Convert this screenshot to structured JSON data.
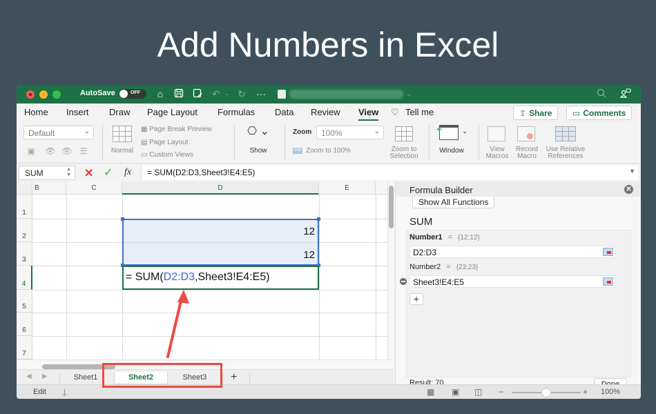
{
  "headline": "Add Numbers in Excel",
  "titlebar": {
    "autosave_label": "AutoSave",
    "autosave_state": "OFF",
    "document_name": "(blurred)",
    "icons": [
      "home-icon",
      "save-icon",
      "save-as-icon",
      "undo-icon",
      "redo-icon",
      "more-icon",
      "excel-doc-icon",
      "search-icon",
      "collaborate-icon"
    ]
  },
  "ribbon_tabs": [
    {
      "label": "Home",
      "active": false
    },
    {
      "label": "Insert",
      "active": false
    },
    {
      "label": "Draw",
      "active": false
    },
    {
      "label": "Page Layout",
      "active": false
    },
    {
      "label": "Formulas",
      "active": false
    },
    {
      "label": "Data",
      "active": false
    },
    {
      "label": "Review",
      "active": false
    },
    {
      "label": "View",
      "active": true
    },
    {
      "label": "Tell me",
      "active": false
    }
  ],
  "share_label": "Share",
  "comments_label": "Comments",
  "ribbon": {
    "sheet_view_select": "Default",
    "normal_label": "Normal",
    "page_break_preview": "Page Break Preview",
    "page_layout": "Page Layout",
    "custom_views": "Custom Views",
    "show_label": "Show",
    "zoom_label": "Zoom",
    "zoom_value": "100%",
    "zoom_to_100": "Zoom to 100%",
    "zoom_badge": "100",
    "zoom_to_selection": [
      "Zoom to",
      "Selection"
    ],
    "window_label": "Window",
    "view_macros": [
      "View",
      "Macros"
    ],
    "record_macro": [
      "Record",
      "Macro"
    ],
    "use_relative": [
      "Use Relative",
      "References"
    ]
  },
  "formula_bar": {
    "name_box": "SUM",
    "formula": "= SUM(D2:D3,Sheet3!E4:E5)",
    "fx_label": "fx"
  },
  "sheet": {
    "columns": [
      "B",
      "C",
      "D",
      "E"
    ],
    "selected_column": "D",
    "rows": [
      "1",
      "2",
      "3",
      "4",
      "5",
      "6",
      "7"
    ],
    "selected_row": "4",
    "cells": {
      "D2": "12",
      "D3": "12"
    },
    "editing_cell": {
      "prefix": "= SUM(",
      "ref": "D2:D3",
      "suffix": ",Sheet3!E4:E5)"
    }
  },
  "sheet_tabs": [
    {
      "label": "Sheet1",
      "active": false
    },
    {
      "label": "Sheet2",
      "active": true
    },
    {
      "label": "Sheet3",
      "active": false
    }
  ],
  "statusbar": {
    "mode": "Edit",
    "zoom_percent": "100%",
    "zoom_slider_fraction": 0.5
  },
  "formula_builder": {
    "title": "Formula Builder",
    "back_label": "Show All Functions",
    "function_name": "SUM",
    "args": [
      {
        "name": "Number1",
        "eq": "=",
        "value": "{12;12}",
        "input": "D2:D3"
      },
      {
        "name": "Number2",
        "eq": "=",
        "value": "{23;23}",
        "input": "Sheet3!E4:E5"
      }
    ],
    "add_label": "+",
    "result": "Result: 70",
    "done_label": "Done"
  },
  "annotation": {
    "color": "#f04a3f"
  }
}
